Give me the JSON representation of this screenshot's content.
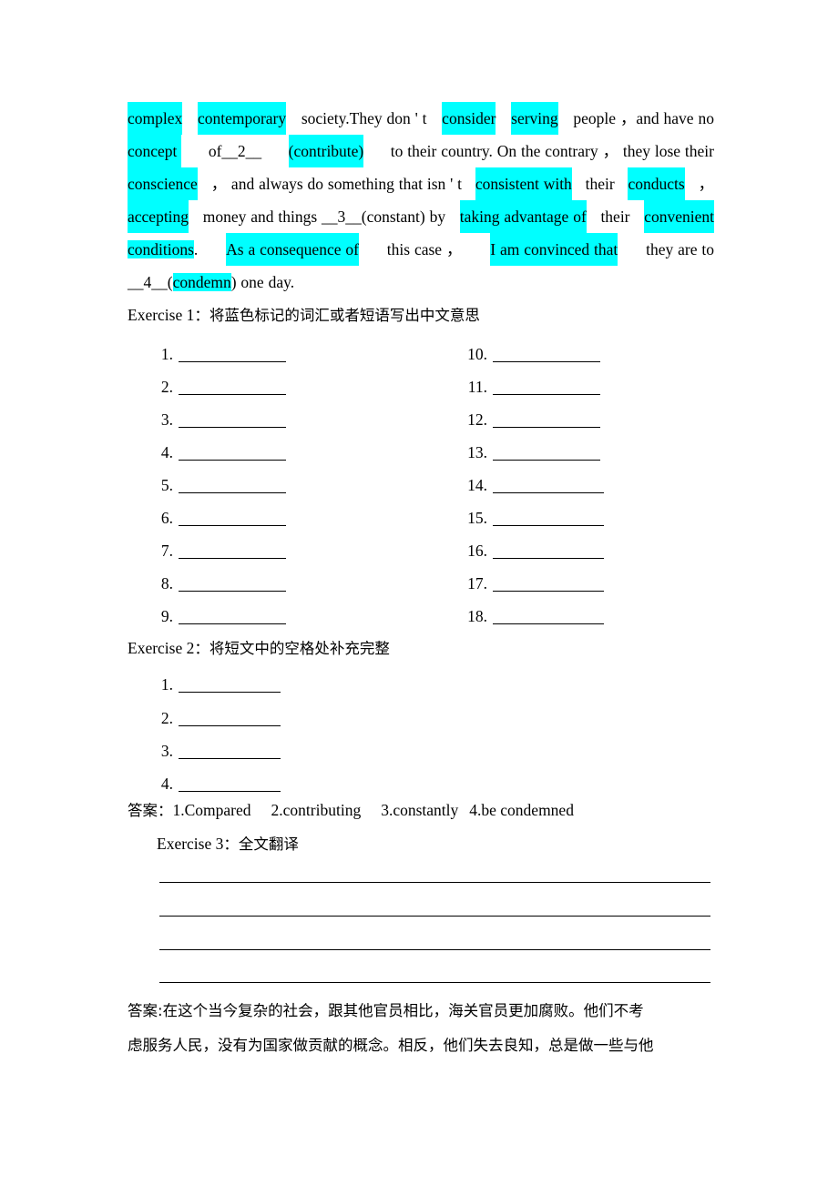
{
  "document": {
    "type": "english-exercise-worksheet",
    "highlight_color": "#00ffff",
    "text_color": "#000000",
    "background": "#ffffff"
  },
  "passage": {
    "lines": [
      {
        "segments": [
          {
            "text": "complex",
            "highlight": true
          },
          {
            "text": " ",
            "highlight": false
          },
          {
            "text": "contemporary",
            "highlight": true
          },
          {
            "text": " society.They don ' t ",
            "highlight": false
          },
          {
            "text": "consider",
            "highlight": true
          },
          {
            "text": " ",
            "highlight": false
          },
          {
            "text": "serving",
            "highlight": true
          },
          {
            "text": " people ，and have no",
            "highlight": false
          }
        ]
      },
      {
        "segments": [
          {
            "text": "concept ",
            "highlight": true
          },
          {
            "text": "of__2__",
            "highlight": false
          },
          {
            "text": "(contribute)",
            "highlight": true
          },
          {
            "text": " to their country. On the contrary ， they lose their",
            "highlight": false
          }
        ]
      },
      {
        "segments": [
          {
            "text": "conscience",
            "highlight": true
          },
          {
            "text": "， and always do something that isn ' t ",
            "highlight": false
          },
          {
            "text": "consistent with",
            "highlight": true
          },
          {
            "text": " their ",
            "highlight": false
          },
          {
            "text": "conducts",
            "highlight": true
          },
          {
            "text": "，",
            "highlight": false
          }
        ]
      },
      {
        "segments": [
          {
            "text": "accepting",
            "highlight": true
          },
          {
            "text": " money and things __3__(constant) by ",
            "highlight": false
          },
          {
            "text": "taking advantage of",
            "highlight": true
          },
          {
            "text": " their ",
            "highlight": false
          },
          {
            "text": "convenient",
            "highlight": true
          }
        ]
      },
      {
        "segments": [
          {
            "text": "conditions",
            "highlight": true
          },
          {
            "text": ". ",
            "highlight": false
          },
          {
            "text": "As a consequence of",
            "highlight": true
          },
          {
            "text": " this case ， ",
            "highlight": false
          },
          {
            "text": "I am convinced that",
            "highlight": true
          },
          {
            "text": " they are to",
            "highlight": false
          }
        ]
      },
      {
        "segments": [
          {
            "text": "__4__(",
            "highlight": false
          },
          {
            "text": "condemn",
            "highlight": true
          },
          {
            "text": ") one day.",
            "highlight": false
          }
        ]
      }
    ]
  },
  "exercise1": {
    "heading_en": "Exercise 1",
    "heading_sep": "：",
    "heading_cn": "将蓝色标记的词汇或者短语写出中文意思",
    "left_numbers": [
      "1.",
      "2.",
      "3.",
      "4.",
      "5.",
      "6.",
      "7.",
      "8.",
      "9."
    ],
    "right_numbers": [
      "10.",
      "11.",
      "12.",
      "13.",
      "14.",
      "15.",
      "16.",
      "17.",
      "18."
    ]
  },
  "exercise2": {
    "heading_en": "Exercise 2",
    "heading_sep": "：",
    "heading_cn": "将短文中的空格处补充完整",
    "numbers": [
      "1.",
      "2.",
      "3.",
      "4."
    ],
    "answer_label": "答案：",
    "answers": [
      "1.Compared",
      "2.contributing",
      "3.constantly",
      "4.be condemned"
    ]
  },
  "exercise3": {
    "heading_en": "Exercise 3",
    "heading_sep": "：",
    "heading_cn": "全文翻译",
    "rule_count": 4,
    "answer_label": "答案:",
    "answer_lines": [
      "在这个当今复杂的社会，跟其他官员相比，海关官员更加腐败。他们不考",
      "虑服务人民，没有为国家做贡献的概念。相反，他们失去良知，总是做一些与他"
    ]
  }
}
